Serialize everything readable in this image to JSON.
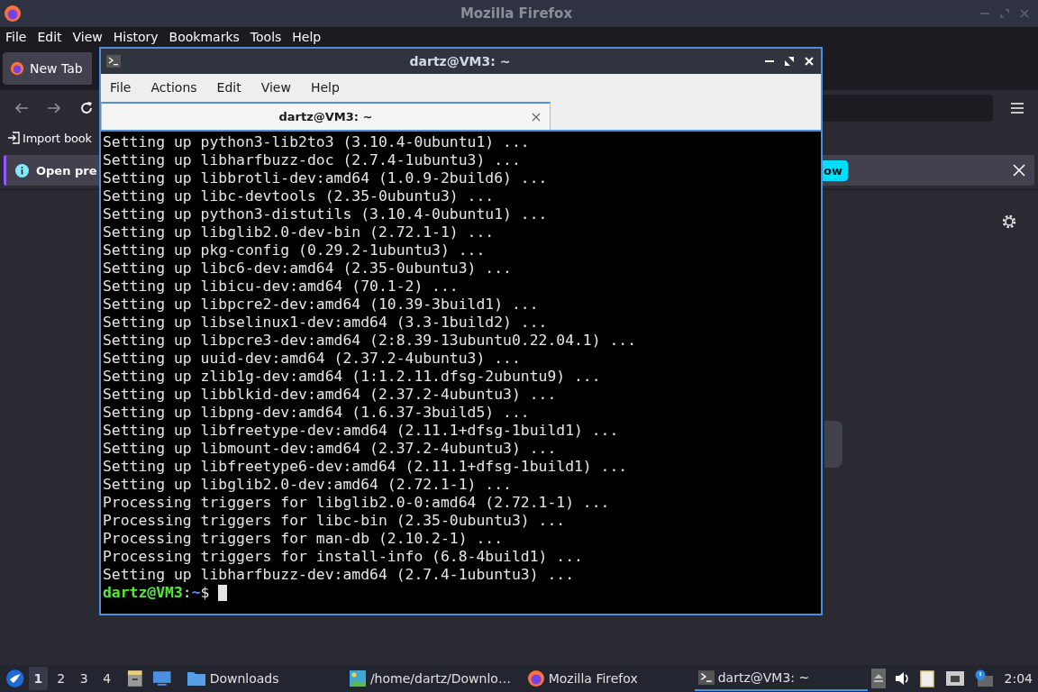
{
  "firefox": {
    "title": "Mozilla Firefox",
    "menu": [
      "File",
      "Edit",
      "View",
      "History",
      "Bookmarks",
      "Tools",
      "Help"
    ],
    "tabs": [
      {
        "label": "New Tab",
        "selected": true
      }
    ],
    "bookmarks": [
      {
        "label": "Import book"
      }
    ],
    "notification": {
      "text": "Open pre",
      "button": "ow"
    }
  },
  "terminal": {
    "title": "dartz@VM3: ~",
    "menu": [
      "File",
      "Actions",
      "Edit",
      "View",
      "Help"
    ],
    "tabs": [
      {
        "label": "dartz@VM3: ~",
        "selected": true
      }
    ],
    "lines": [
      "Setting up python3-lib2to3 (3.10.4-0ubuntu1) ...",
      "Setting up libharfbuzz-doc (2.7.4-1ubuntu3) ...",
      "Setting up libbrotli-dev:amd64 (1.0.9-2build6) ...",
      "Setting up libc-devtools (2.35-0ubuntu3) ...",
      "Setting up python3-distutils (3.10.4-0ubuntu1) ...",
      "Setting up libglib2.0-dev-bin (2.72.1-1) ...",
      "Setting up pkg-config (0.29.2-1ubuntu3) ...",
      "Setting up libc6-dev:amd64 (2.35-0ubuntu3) ...",
      "Setting up libicu-dev:amd64 (70.1-2) ...",
      "Setting up libpcre2-dev:amd64 (10.39-3build1) ...",
      "Setting up libselinux1-dev:amd64 (3.3-1build2) ...",
      "Setting up libpcre3-dev:amd64 (2:8.39-13ubuntu0.22.04.1) ...",
      "Setting up uuid-dev:amd64 (2.37.2-4ubuntu3) ...",
      "Setting up zlib1g-dev:amd64 (1:1.2.11.dfsg-2ubuntu9) ...",
      "Setting up libblkid-dev:amd64 (2.37.2-4ubuntu3) ...",
      "Setting up libpng-dev:amd64 (1.6.37-3build5) ...",
      "Setting up libfreetype-dev:amd64 (2.11.1+dfsg-1build1) ...",
      "Setting up libmount-dev:amd64 (2.37.2-4ubuntu3) ...",
      "Setting up libfreetype6-dev:amd64 (2.11.1+dfsg-1build1) ...",
      "Setting up libglib2.0-dev:amd64 (2.72.1-1) ...",
      "Processing triggers for libglib2.0-0:amd64 (2.72.1-1) ...",
      "Processing triggers for libc-bin (2.35-0ubuntu3) ...",
      "Processing triggers for man-db (2.10.2-1) ...",
      "Processing triggers for install-info (6.8-4build1) ...",
      "Setting up libharfbuzz-dev:amd64 (2.7.4-1ubuntu3) ..."
    ],
    "prompt": {
      "user_host": "dartz@VM3",
      "separator": ":",
      "path": "~",
      "symbol": "$"
    }
  },
  "taskbar": {
    "workspaces": [
      {
        "label": "1",
        "selected": true
      },
      {
        "label": "2",
        "selected": false
      },
      {
        "label": "3",
        "selected": false
      },
      {
        "label": "4",
        "selected": false
      }
    ],
    "tasks": [
      {
        "kind": "folder",
        "label": "Downloads",
        "selected": false
      },
      {
        "kind": "image",
        "label": "/home/dartz/Downlo…",
        "selected": false
      },
      {
        "kind": "firefox",
        "label": "Mozilla Firefox",
        "selected": false
      },
      {
        "kind": "terminal",
        "label": "dartz@VM3: ~",
        "selected": true
      }
    ],
    "clock": "2:04"
  }
}
